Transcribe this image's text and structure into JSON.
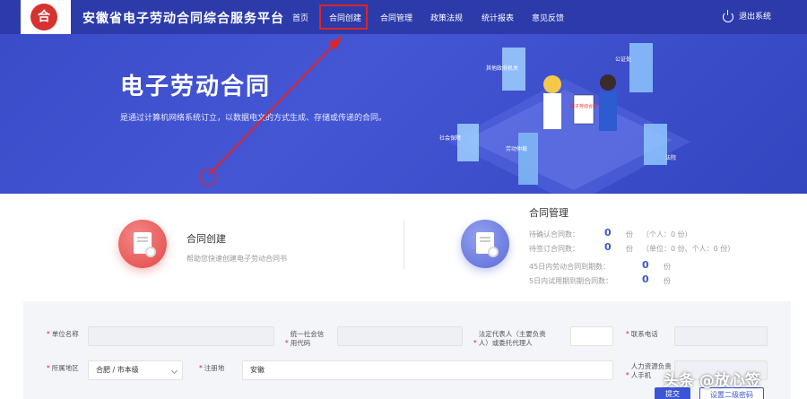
{
  "header": {
    "logo_glyph": "合",
    "site_title": "安徽省电子劳动合同综合服务平台",
    "nav": [
      {
        "label": "首页",
        "active": true
      },
      {
        "label": "合同创建",
        "active": false
      },
      {
        "label": "合同管理",
        "active": false
      },
      {
        "label": "政策法规",
        "active": false
      },
      {
        "label": "统计报表",
        "active": false
      },
      {
        "label": "意见反馈",
        "active": false
      }
    ],
    "logout_label": "退出系统"
  },
  "banner": {
    "title": "电子劳动合同",
    "description": "是通过计算机网络系统订立，以数据电文的方式生成、存储或传递的合同。",
    "illustration_labels": [
      "其他政府机关",
      "公证处",
      "社会保障",
      "劳动仲裁",
      "法院",
      "电子劳动合同"
    ]
  },
  "cards": {
    "create": {
      "title": "合同创建",
      "subtitle": "帮助您快速创建电子劳动合同书"
    },
    "manage": {
      "title": "合同管理",
      "stats": [
        {
          "label": "待确认合同数：",
          "value": "0",
          "unit": "份",
          "note": "（个人：0 份）"
        },
        {
          "label": "待签订合同数：",
          "value": "0",
          "unit": "份",
          "note": "（单位：0 份、个人：0 份）"
        },
        {
          "label": "45日内劳动合同到期数：",
          "value": "0",
          "unit": "份",
          "note": ""
        },
        {
          "label": "5日内试用期到期合同数：",
          "value": "0",
          "unit": "份",
          "note": ""
        }
      ]
    }
  },
  "form": {
    "company_name_label": "单位名称",
    "credit_code_label": "统一社会信用代码",
    "legal_rep_label": "法定代表人（主要负责人）或委托代理人",
    "phone_label": "联系电话",
    "region_label": "所属地区",
    "region_value": "合肥 / 市本级",
    "address_label": "注册地",
    "address_value": "安徽",
    "hr_label": "人力资源负责人手机",
    "submit_label": "提交",
    "password_label": "设置二级密码"
  },
  "watermark": "头条 @放心签",
  "colors": {
    "header": "#2c3ba9",
    "banner": "#3a4cc8",
    "accent": "#3a56d4",
    "highlight": "#e02424"
  }
}
